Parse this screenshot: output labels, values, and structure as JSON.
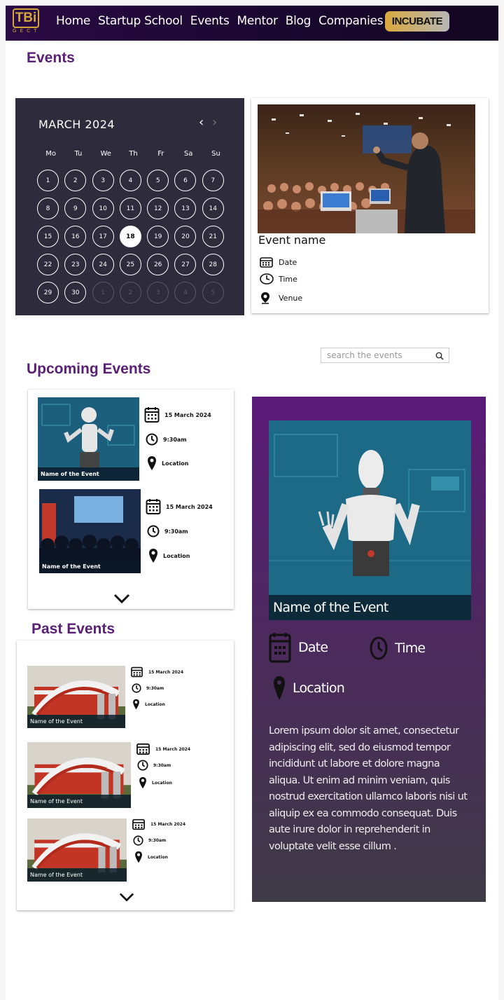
{
  "nav": {
    "logo_text": "TBi",
    "logo_sub": "GECT",
    "links": [
      "Home",
      "Startup School",
      "Events",
      "Mentor",
      "Blog",
      "Companies"
    ],
    "cta": "INCUBATE"
  },
  "events_heading": "Events",
  "calendar": {
    "month": "MARCH 2024",
    "weekdays": [
      "Mo",
      "Tu",
      "We",
      "Th",
      "Fr",
      "Sa",
      "Su"
    ],
    "selected_day": 18,
    "days": [
      "1",
      "2",
      "3",
      "4",
      "5",
      "6",
      "7",
      "8",
      "9",
      "10",
      "11",
      "12",
      "13",
      "14",
      "15",
      "16",
      "17",
      "18",
      "19",
      "20",
      "21",
      "22",
      "23",
      "24",
      "25",
      "26",
      "27",
      "28",
      "29",
      "30",
      "1",
      "2",
      "3",
      "4",
      "5"
    ]
  },
  "event_card": {
    "name": "Event name",
    "date_label": "Date",
    "time_label": "Time",
    "venue_label": "Venue"
  },
  "search": {
    "placeholder": "search the events"
  },
  "upcoming": {
    "heading": "Upcoming Events",
    "items": [
      {
        "title": "Name of the Event",
        "date": "15 March 2024",
        "time": "9:30am",
        "location": "Location"
      },
      {
        "title": "Name of the Event",
        "date": "15 March 2024",
        "time": "9:30am",
        "location": "Location"
      }
    ]
  },
  "past": {
    "heading": "Past Events",
    "items": [
      {
        "title": "Name of the Event",
        "date": "15 March 2024",
        "time": "9:30am",
        "location": "Location"
      },
      {
        "title": "Name of the Event",
        "date": "15 March 2024",
        "time": "9:30am",
        "location": "Location"
      },
      {
        "title": "Name of the Event",
        "date": "15 March 2024",
        "time": "9:30am",
        "location": "Location"
      }
    ]
  },
  "featured": {
    "title": "Name of the Event",
    "date_label": "Date",
    "time_label": "Time",
    "location_label": "Location",
    "description": "Lorem ipsum dolor sit amet, consectetur adipiscing elit, sed do eiusmod tempor incididunt ut labore et dolore magna aliqua. Ut enim ad minim veniam, quis nostrud exercitation ullamco laboris nisi ut aliquip ex ea commodo consequat. Duis aute irure dolor in reprehenderit in voluptate velit esse cillum ."
  },
  "colors": {
    "accent_purple": "#5a2075",
    "nav_bg": "#1a0830",
    "cta_gold": "#d9a93c",
    "calendar_bg": "#2e2c3c"
  }
}
